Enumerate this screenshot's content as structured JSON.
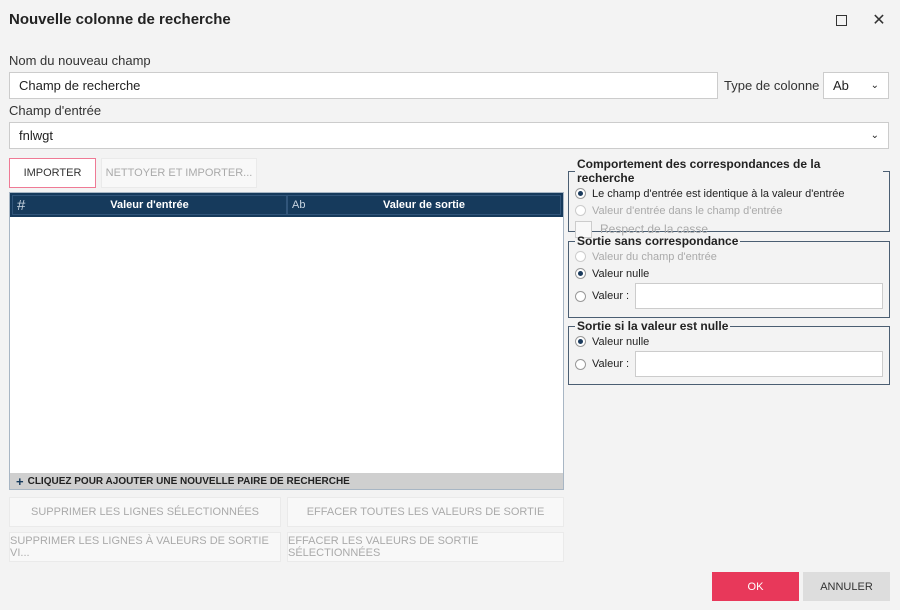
{
  "dialog": {
    "title": "Nouvelle colonne de recherche",
    "maximize_icon": "maximize-icon",
    "close_icon": "close-icon"
  },
  "form": {
    "new_field_label": "Nom du nouveau champ",
    "new_field_value": "Champ de recherche",
    "column_type_label": "Type de colonne :",
    "column_type_value": "Ab",
    "input_field_label": "Champ d'entrée",
    "input_field_value": "fnlwgt"
  },
  "buttons": {
    "import": "IMPORTER",
    "clean_import": "NETTOYER ET IMPORTER...",
    "delete_selected": "SUPPRIMER LES LIGNES SÉLECTIONNÉES",
    "clear_all_outputs": "EFFACER TOUTES LES VALEURS DE SORTIE",
    "delete_empty_output": "SUPPRIMER LES LIGNES À VALEURS DE SORTIE VI...",
    "clear_selected_outputs": "EFFACER LES VALEURS DE SORTIE SÉLECTIONNÉES",
    "ok": "OK",
    "cancel": "ANNULER"
  },
  "grid": {
    "col1_icon": "#",
    "col1": "Valeur d'entrée",
    "col2_icon": "Ab",
    "col2": "Valeur de sortie",
    "add_row": "CLIQUEZ POUR AJOUTER UNE NOUVELLE PAIRE DE RECHERCHE",
    "rows": []
  },
  "match_behavior": {
    "title": "Comportement des correspondances de la recherche",
    "opt1": "Le champ d'entrée est identique à la valeur d'entrée",
    "opt2": "Valeur d'entrée dans le champ d'entrée",
    "case": "Respect de la casse",
    "selected": "opt1"
  },
  "no_match": {
    "title": "Sortie sans correspondance",
    "opt1": "Valeur du champ d'entrée",
    "opt2": "Valeur nulle",
    "opt3": "Valeur :",
    "value": "",
    "selected": "opt2"
  },
  "null_output": {
    "title": "Sortie si la valeur est nulle",
    "opt1": "Valeur nulle",
    "opt2": "Valeur :",
    "value": "",
    "selected": "opt1"
  },
  "colors": {
    "accent": "#e8385a",
    "header": "#163a5c"
  }
}
